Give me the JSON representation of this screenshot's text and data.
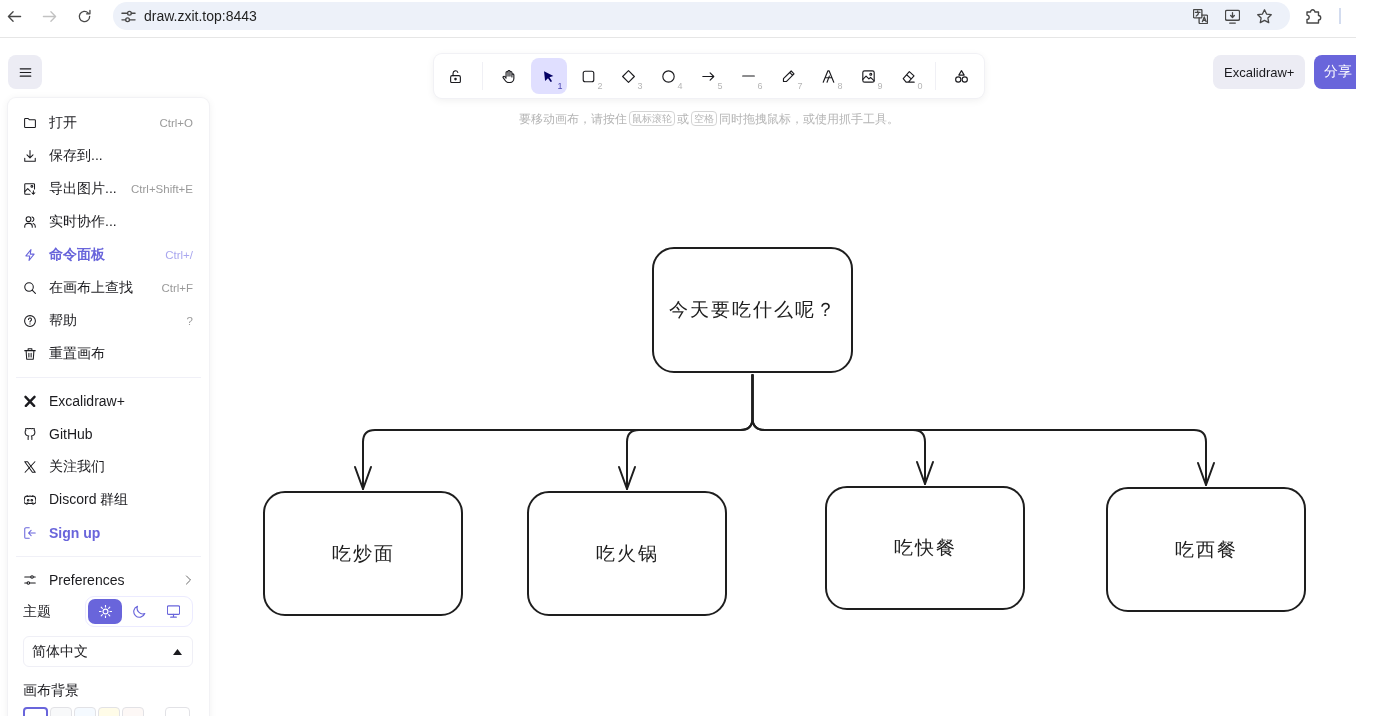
{
  "browser": {
    "url": "draw.zxit.top:8443",
    "forward_disabled": true
  },
  "main_menu": {
    "items": [
      {
        "label": "打开",
        "shortcut": "Ctrl+O",
        "highlighted": false
      },
      {
        "label": "保存到...",
        "highlighted": false
      },
      {
        "label": "导出图片...",
        "shortcut": "Ctrl+Shift+E",
        "highlighted": false
      },
      {
        "label": "实时协作...",
        "highlighted": false
      },
      {
        "label": "命令面板",
        "shortcut": "Ctrl+/",
        "highlighted": true
      },
      {
        "label": "在画布上查找",
        "shortcut": "Ctrl+F",
        "highlighted": false
      },
      {
        "label": "帮助",
        "shortcut": "?",
        "highlighted": false
      },
      {
        "label": "重置画布",
        "highlighted": false
      }
    ],
    "links": [
      {
        "label": "Excalidraw+",
        "highlighted": false
      },
      {
        "label": "GitHub",
        "highlighted": false
      },
      {
        "label": "关注我们",
        "highlighted": false
      },
      {
        "label": "Discord 群组",
        "highlighted": false
      },
      {
        "label": "Sign up",
        "highlighted": true
      }
    ],
    "preferences": {
      "label": "Preferences"
    },
    "theme": {
      "label": "主题",
      "options": [
        {
          "selected": true
        },
        {
          "selected": false
        },
        {
          "selected": false
        }
      ]
    },
    "language": {
      "value": "简体中文"
    },
    "canvas_background": {
      "label": "画布背景",
      "swatches": [
        {
          "kind": "preset",
          "color": "#ffffff",
          "selected": true
        },
        {
          "kind": "preset",
          "color": "#f8f9fa",
          "selected": false
        },
        {
          "kind": "preset",
          "color": "#f5faff",
          "selected": false
        },
        {
          "kind": "preset",
          "color": "#fffce8",
          "selected": false
        },
        {
          "kind": "preset",
          "color": "#fdf8f6",
          "selected": false
        },
        {
          "kind": "custom",
          "color": "#ffffff",
          "selected": false
        }
      ]
    }
  },
  "toolbar": {
    "tools": [
      {
        "selected": false
      },
      {
        "selected": false
      },
      {
        "shortcut": "1",
        "selected": true
      },
      {
        "shortcut": "2",
        "selected": false
      },
      {
        "shortcut": "3",
        "selected": false
      },
      {
        "shortcut": "4",
        "selected": false
      },
      {
        "shortcut": "5",
        "selected": false
      },
      {
        "shortcut": "6",
        "selected": false
      },
      {
        "shortcut": "7",
        "selected": false
      },
      {
        "shortcut": "8",
        "selected": false
      },
      {
        "shortcut": "9",
        "selected": false
      },
      {
        "shortcut": "0",
        "selected": false
      },
      {
        "selected": false
      }
    ]
  },
  "hint": [
    {
      "kind": "text",
      "text": "要移动画布，请按住"
    },
    {
      "kind": "key",
      "text": "鼠标滚轮"
    },
    {
      "kind": "text",
      "text": "或"
    },
    {
      "kind": "key",
      "text": "空格"
    },
    {
      "kind": "text",
      "text": "同时拖拽鼠标，或使用抓手工具。"
    }
  ],
  "header_buttons": [
    {
      "kind": "secondary",
      "label": "Excalidraw+"
    },
    {
      "kind": "primary",
      "label": "分享"
    }
  ],
  "canvas": {
    "root": {
      "label": "今天要吃什么呢？",
      "children": [
        {
          "label": "吃炒面"
        },
        {
          "label": "吃火锅"
        },
        {
          "label": "吃快餐"
        },
        {
          "label": "吃西餐"
        }
      ]
    }
  }
}
